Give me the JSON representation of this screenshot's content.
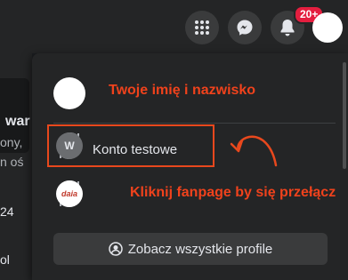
{
  "header": {
    "icons": [
      "menu-grid-icon",
      "messenger-icon",
      "bell-icon"
    ],
    "notifications_badge": "20+",
    "badge_color": "#e41e3f"
  },
  "background_fragments": [
    {
      "text": "war",
      "style": "bold"
    },
    {
      "text": "ony,",
      "style": "dim"
    },
    {
      "text": "n oś",
      "style": "dim"
    },
    {
      "text": "24",
      "style": "normal"
    },
    {
      "text": "ol",
      "style": "normal"
    }
  ],
  "menu": {
    "profile_annotation": "Twoje imię i nazwisko",
    "test_account_label": "Konto testowe",
    "test_account_initial": "W",
    "fanpage_logo_text": "daia",
    "fanpage_annotation": "Kliknij fanpage by się przełącz",
    "see_all_label": "Zobacz wszystkie profile"
  },
  "colors": {
    "annotation": "#f0421c",
    "background": "#242526",
    "button": "#3a3b3c"
  }
}
